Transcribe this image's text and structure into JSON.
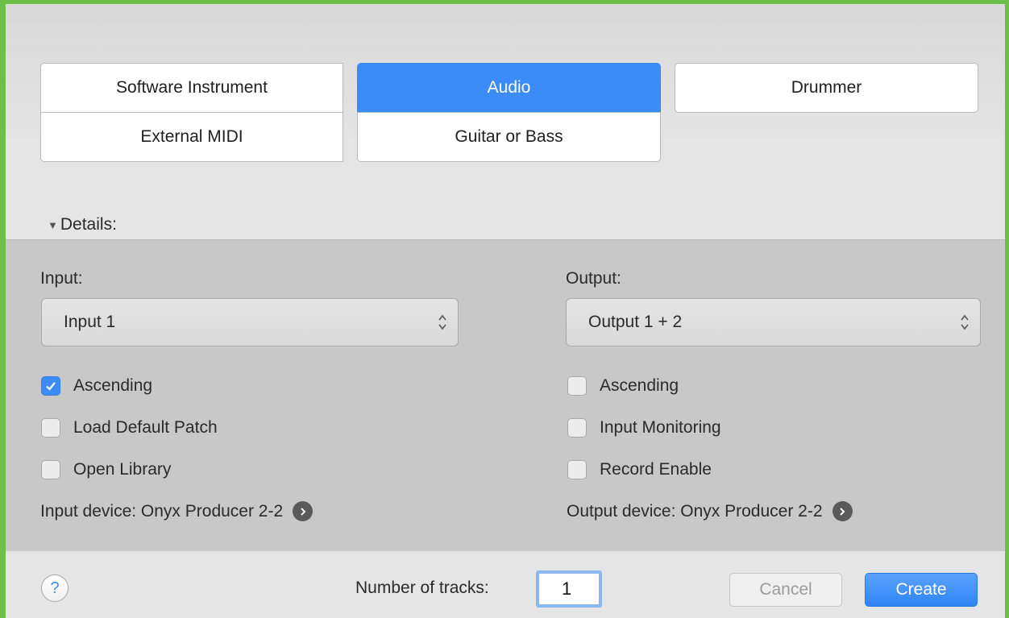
{
  "track_types": {
    "software_instrument": "Software Instrument",
    "audio": "Audio",
    "drummer": "Drummer",
    "external_midi": "External MIDI",
    "guitar_or_bass": "Guitar or Bass",
    "selected": "Audio"
  },
  "details": {
    "toggle_label": "Details:",
    "input": {
      "label": "Input:",
      "value": "Input 1",
      "options": [
        {
          "label": "Ascending",
          "checked": true
        },
        {
          "label": "Load Default Patch",
          "checked": false
        },
        {
          "label": "Open Library",
          "checked": false
        }
      ],
      "device": "Input device: Onyx Producer 2-2"
    },
    "output": {
      "label": "Output:",
      "value": "Output 1 + 2",
      "options": [
        {
          "label": "Ascending",
          "checked": false
        },
        {
          "label": "Input Monitoring",
          "checked": false
        },
        {
          "label": "Record Enable",
          "checked": false
        }
      ],
      "device": "Output device: Onyx Producer 2-2"
    }
  },
  "footer": {
    "help": "?",
    "tracks_label": "Number of tracks:",
    "tracks_value": "1",
    "cancel_label": "Cancel",
    "create_label": "Create"
  },
  "colors": {
    "accent": "#3b8cf7",
    "frame": "#6cc04a",
    "panel": "#c8c8c8"
  },
  "icons": {
    "disclosure": "disclosure-triangle-icon",
    "popup": "updown-chevron-icon",
    "device": "arrow-right-circle-icon",
    "check": "checkmark-icon"
  }
}
